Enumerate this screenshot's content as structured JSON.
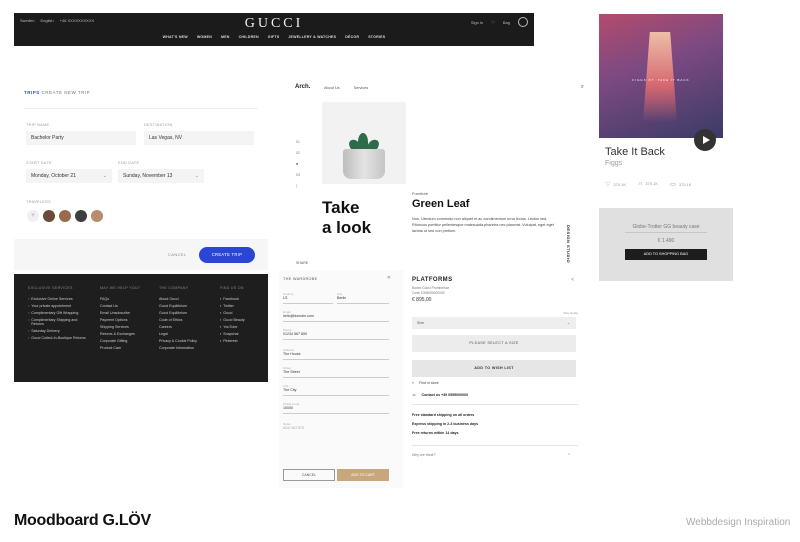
{
  "gucci": {
    "logo": "GUCCI",
    "topbar": [
      "Sweden",
      "English",
      "+46 XXXXXXXXXX"
    ],
    "right": [
      "Sign In",
      "Bag"
    ],
    "nav": [
      "WHAT'S NEW",
      "WOMEN",
      "MEN",
      "CHILDREN",
      "GIFTS",
      "JEWELLERY & WATCHES",
      "DÉCOR",
      "STORIES"
    ]
  },
  "album": {
    "title": "Take It Back",
    "artist": "Figgs",
    "cover_caption": "FIGGS FT. TAKE IT BACK",
    "stats": [
      {
        "icon": "heart-icon",
        "value": "370.1K"
      },
      {
        "icon": "headphones-icon",
        "value": "370.1K"
      },
      {
        "icon": "chat-icon",
        "value": "370.1K"
      }
    ]
  },
  "beauty": {
    "name": "Globe-Trotter GG beauty case",
    "price": "€ 1.490",
    "button": "ADD TO SHOPPING BAG"
  },
  "trip": {
    "section": "TRIPS",
    "title": "CREATE NEW TRIP",
    "trip_name_label": "TRIP NAME",
    "trip_name_value": "Bachelor Party",
    "destination_label": "DESTINATION",
    "destination_value": "Las Vegas, NV",
    "start_label": "START DATE",
    "start_value": "Monday, October 21",
    "end_label": "END DATE",
    "end_value": "Sunday, November 13",
    "travelers_label": "TRAVELERS",
    "cancel": "CANCEL",
    "create": "CREATE TRIP"
  },
  "footer": {
    "columns": [
      {
        "heading": "EXCLUSIVE SERVICES",
        "items": [
          "Exclusive Online Services",
          "Your private appointment",
          "Complimentary Gift Wrapping",
          "Complimentary Shipping and Returns",
          "Saturday Delivery",
          "Gucci Collect-In-Boutique Returns"
        ]
      },
      {
        "heading": "MAY WE HELP YOU?",
        "items": [
          "FAQs",
          "Contact Us",
          "Email Unsubscribe",
          "Payment Options",
          "Shipping Services",
          "Returns & Exchanges",
          "Corporate Gifting",
          "Product Care"
        ]
      },
      {
        "heading": "THE COMPANY",
        "items": [
          "About Gucci",
          "Gucci Equilibrium",
          "Gucci Equilibrium",
          "Code of Ethics",
          "Careers",
          "Legal",
          "Privacy & Cookie Policy",
          "Corporate Information"
        ]
      },
      {
        "heading": "FIND US ON",
        "items": [
          "Facebook",
          "Twitter",
          "Gucci",
          "Gucci Beauty",
          "YouTube",
          "Snapchat",
          "Pinterest"
        ]
      }
    ]
  },
  "arch": {
    "brand": "Arch.",
    "menu": [
      "About Us",
      "Services"
    ],
    "pager": [
      "01",
      "02",
      "03"
    ],
    "take": [
      "Take",
      "a look"
    ],
    "category": "Furniture",
    "product": "Green Leaf",
    "description": "Non, Uterdum commodo non aliquet et ac condimentum urna lectus. Lectus sed, Rhoncus porttitor pellentesque malesuada pharetra nec placerat. Volutpat, eget eget lacinia ut sed non pretium.",
    "vertical": "DESIGN STUDIO",
    "share": "SHARE"
  },
  "address": {
    "title": "THE WARDROBE",
    "fields": [
      {
        "label": "Country",
        "value": "LS"
      },
      {
        "label": "City",
        "value": "Berlin"
      },
      {
        "label": "Email",
        "value": "hello@domain.com"
      },
      {
        "label": "Phone",
        "value": "01234 567 890"
      },
      {
        "label": "Address",
        "value": "The House"
      },
      {
        "label": "Street",
        "value": "The Street"
      },
      {
        "label": "City",
        "value": "The City"
      },
      {
        "label": "Postal Code",
        "value": "10000"
      },
      {
        "label": "Notes",
        "value": "ADD NOTES"
      }
    ],
    "cancel": "CANCEL",
    "add": "ADD TO CART"
  },
  "platforms": {
    "title": "PLATFORMS",
    "sub_lines": [
      "Boxed Gucci Prominence",
      "Code 1005000000000"
    ],
    "price": "€ 895,00",
    "size_guide": "Size Guide",
    "size_select": "Size",
    "select_size": "PLEASE SELECT A SIZE",
    "wishlist": "ADD TO WISH LIST",
    "find_store": "Find in store",
    "contact": "Contact us +39 0555000000",
    "shipping": [
      "Free standard shipping on all orders",
      "Express shipping in 2-3 business days",
      "Free returns within 14 days"
    ],
    "why_buy": "Why we think?"
  },
  "labels": {
    "moodboard": "Moodboard G.LÖV",
    "inspiration": "Webbdesign Inspiration"
  }
}
